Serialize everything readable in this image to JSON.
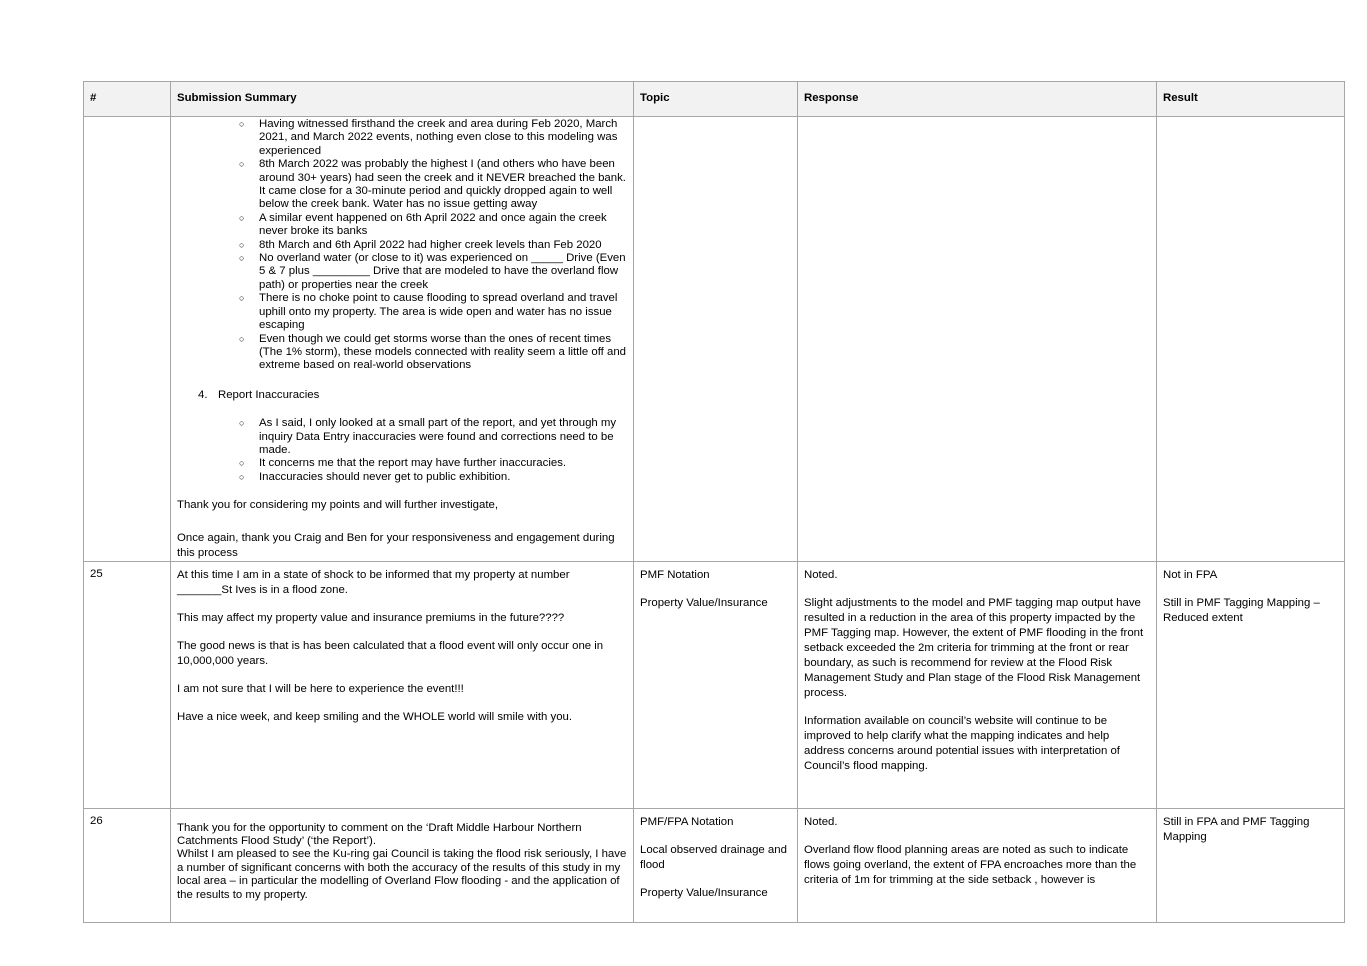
{
  "headers": {
    "num": "#",
    "summary": "Submission Summary",
    "topic": "Topic",
    "response": "Response",
    "result": "Result"
  },
  "row_continued": {
    "bullets_a": [
      "Having witnessed firsthand the creek and area during Feb 2020, March 2021, and March 2022 events, nothing even close to this modeling was experienced",
      "8th March 2022 was probably the highest I (and others who have been around 30+ years) had seen the creek and it NEVER breached the bank. It came close for a 30-minute period and quickly dropped again to well below the creek bank. Water has no issue getting away",
      "A similar event happened on 6th April 2022 and once again the creek never broke its banks",
      "8th March and 6th April 2022 had higher creek levels than Feb 2020",
      "No overland water (or close to it) was experienced on _____ Drive (Even 5 & 7 plus _________ Drive that are modeled to have the overland flow path) or properties near the creek",
      "There is no choke point to cause flooding to spread overland and travel uphill onto my property. The area is wide open and water has no issue escaping",
      "Even though we could get storms worse than the ones of recent times (The 1% storm), these models connected with reality seem a little off and extreme based on real-world observations"
    ],
    "item4_num": "4.",
    "item4_label": "Report Inaccuracies",
    "bullets_b": [
      "As I said, I only looked at a small part of the report, and yet through my inquiry Data Entry inaccuracies were found and corrections need to be made.",
      "It concerns me that the report may have further inaccuracies.",
      "Inaccuracies should never get to public exhibition."
    ],
    "thanks1": "Thank you for considering my points and will further investigate,",
    "thanks2": " Once again, thank you Craig and Ben for your responsiveness and engagement during this process"
  },
  "row_25": {
    "num": "25",
    "summary": [
      "At this time I am in a state of shock to be informed that my property at number _______St Ives is in a flood zone.",
      "This may affect my property value and insurance premiums in the future????",
      "The good news is that is has been calculated that a flood event will only occur one in 10,000,000 years.",
      "I am not sure that I will be here to experience the event!!!",
      "Have a nice week, and keep smiling and the WHOLE world will smile with you."
    ],
    "topic": [
      "PMF Notation",
      "Property Value/Insurance"
    ],
    "response": [
      "Noted.",
      "Slight adjustments to the model and PMF tagging map output have resulted in a reduction in the area of this property impacted by the PMF Tagging map. However, the extent of PMF flooding in the front setback exceeded the 2m criteria for trimming at the front or rear boundary, as such is recommend for review at the Flood Risk Management Study and Plan stage of the Flood Risk Management process.",
      "Information available on council’s website will continue to be improved to help clarify what the mapping indicates and help address concerns around potential issues with interpretation of Council’s flood mapping."
    ],
    "result": [
      "Not in FPA",
      "Still in PMF Tagging Mapping – Reduced extent"
    ]
  },
  "row_26": {
    "num": "26",
    "summary_a": " Thank you for the opportunity to comment on the ‘Draft Middle Harbour Northern Catchments Flood Study’ (‘the Report’).",
    "summary_b": "Whilst I am pleased to see the Ku-ring gai Council is taking the flood risk seriously, I have a number of significant concerns with both the accuracy of the results of this study in my local area – in particular the modelling of Overland Flow flooding - and the application of the results to my property.",
    "topic": [
      "PMF/FPA Notation",
      "Local observed drainage and flood",
      "Property Value/Insurance"
    ],
    "response": [
      "Noted.",
      "Overland flow flood planning areas are noted as such to indicate flows going overland, the extent of FPA encroaches more than the criteria of 1m for trimming at the side setback , however is"
    ],
    "result": [
      "Still in FPA and PMF Tagging Mapping"
    ]
  }
}
